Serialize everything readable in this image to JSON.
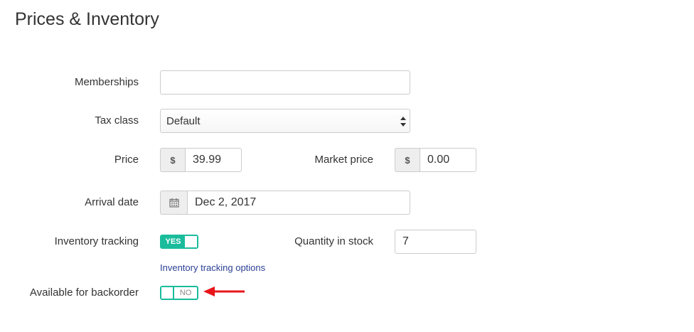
{
  "page": {
    "title": "Prices & Inventory"
  },
  "form": {
    "memberships": {
      "label": "Memberships",
      "value": ""
    },
    "tax_class": {
      "label": "Tax class",
      "value": "Default"
    },
    "price": {
      "label": "Price",
      "currency": "$",
      "value": "39.99"
    },
    "market_price": {
      "label": "Market price",
      "currency": "$",
      "value": "0.00"
    },
    "arrival_date": {
      "label": "Arrival date",
      "value": "Dec 2, 2017",
      "icon": "calendar-icon"
    },
    "inventory_tracking": {
      "label": "Inventory tracking",
      "state": "YES",
      "enabled": true
    },
    "inventory_tracking_options": {
      "link": "Inventory tracking options"
    },
    "quantity_in_stock": {
      "label": "Quantity in stock",
      "value": "7"
    },
    "backorder": {
      "label": "Available for backorder",
      "state": "NO",
      "enabled": false
    }
  },
  "colors": {
    "accent": "#1abc9c",
    "link": "#2a3f96",
    "annotation_arrow": "#e8151b"
  }
}
